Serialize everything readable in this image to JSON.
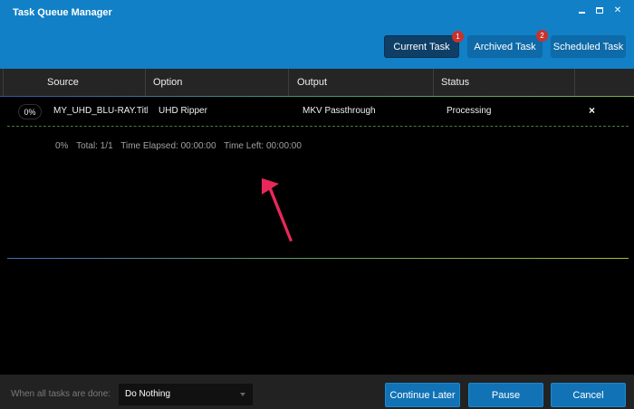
{
  "window": {
    "title": "Task Queue Manager",
    "controls": {
      "minimize": "minimize",
      "maximize": "maximize",
      "close": "✕"
    }
  },
  "tabs": {
    "current": {
      "label": "Current Task",
      "badge": "1"
    },
    "archived": {
      "label": "Archived Task",
      "badge": "2"
    },
    "scheduled": {
      "label": "Scheduled Task"
    }
  },
  "table": {
    "headers": [
      "Source",
      "Option",
      "Output",
      "Status"
    ],
    "rows": [
      {
        "progress": "0%",
        "source": "MY_UHD_BLU-RAY.Title",
        "option": "UHD Ripper",
        "output": "MKV Passthrough",
        "status": "Processing",
        "remove": "×"
      }
    ]
  },
  "progress": {
    "percent": "0%",
    "total": "Total: 1/1",
    "elapsed": "Time Elapsed: 00:00:00",
    "left": "Time Left: 00:00:00"
  },
  "footer": {
    "when_done_label": "When all tasks are done:",
    "when_done_value": "Do Nothing",
    "continue_later": "Continue Later",
    "pause": "Pause",
    "cancel": "Cancel"
  },
  "colors": {
    "header_bg": "#1180c6",
    "tab_active": "#0f3f66",
    "badge": "#c8322b",
    "button": "#1173b6",
    "annotation_arrow": "#e8285a"
  }
}
